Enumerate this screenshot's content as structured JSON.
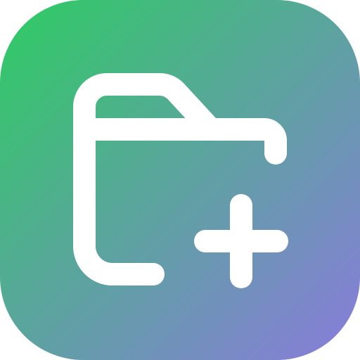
{
  "icon": {
    "name": "folder-add-icon",
    "gradient_start": "#2ecc62",
    "gradient_end": "#8a7bdc",
    "glyph_color": "#ffffff"
  }
}
